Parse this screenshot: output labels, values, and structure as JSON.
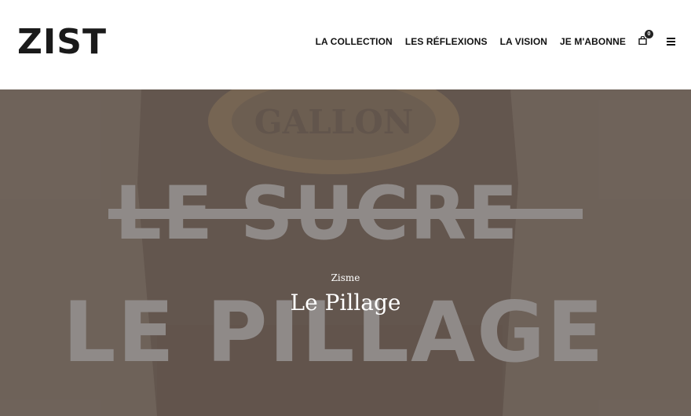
{
  "header": {
    "logo": "ZIST",
    "nav": [
      {
        "label": "LA COLLECTION"
      },
      {
        "label": "LES RÉFLEXIONS"
      },
      {
        "label": "LA VISION"
      },
      {
        "label": "JE M'ABONNE"
      }
    ],
    "cart_count": "0",
    "cart_icon": "shopping-bag-icon",
    "menu_icon": "hamburger-menu-icon"
  },
  "hero": {
    "bg_words": [
      "LE SUCRE",
      "LE PILLAGE"
    ],
    "package_text": "GALLON",
    "category": "Zisme",
    "title": "Le Pillage",
    "colors": {
      "overlay": "#6e6259",
      "bg_text": "#8f8a88",
      "foreground_text": "#ffffff"
    }
  }
}
